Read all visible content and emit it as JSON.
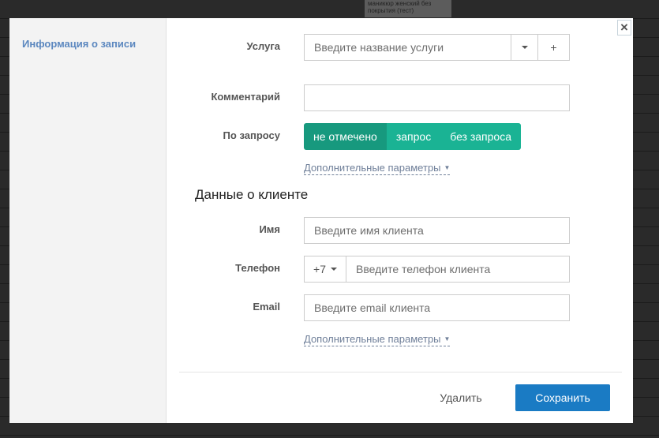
{
  "background": {
    "cell_text": "маникюр женский без покрытия (тест)"
  },
  "sidebar": {
    "items": [
      {
        "label": "Информация о записи"
      }
    ]
  },
  "close": {
    "symbol": "×"
  },
  "booking": {
    "service": {
      "label": "Услуга",
      "placeholder": "Введите название услуги",
      "add_symbol": "+"
    },
    "comment": {
      "label": "Комментарий",
      "value": ""
    },
    "on_request": {
      "label": "По запросу",
      "options": [
        {
          "label": "не отмечено"
        },
        {
          "label": "запрос"
        },
        {
          "label": "без запроса"
        }
      ],
      "selected": "не отмечено"
    },
    "extra_label": "Дополнительные параметры"
  },
  "client": {
    "title": "Данные о клиенте",
    "name": {
      "label": "Имя",
      "placeholder": "Введите имя клиента"
    },
    "phone": {
      "label": "Телефон",
      "code": "+7",
      "placeholder": "Введите телефон клиента"
    },
    "email": {
      "label": "Email",
      "placeholder": "Введите email клиента"
    },
    "extra_label": "Дополнительные параметры"
  },
  "footer": {
    "delete_label": "Удалить",
    "save_label": "Сохранить"
  },
  "colors": {
    "accent_green": "#1ab394",
    "active_green": "#17997e",
    "save_blue": "#1a7bc4",
    "link_blue": "#5b87bf"
  },
  "icons": {
    "close": "close-icon",
    "dropdown": "chevron-down-icon",
    "add": "plus-icon"
  }
}
